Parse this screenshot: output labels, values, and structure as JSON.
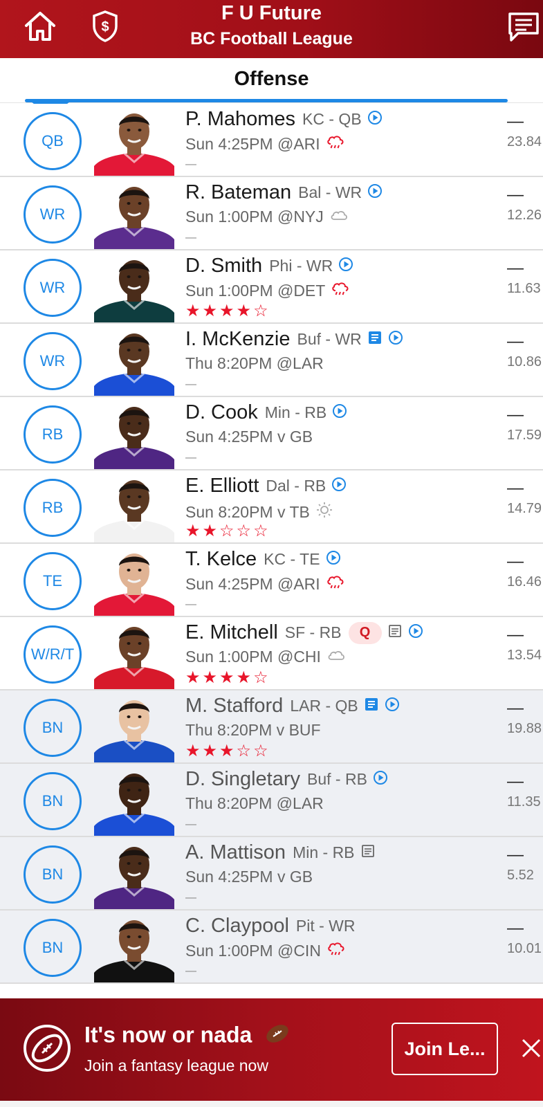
{
  "header": {
    "title": "F U Future",
    "subtitle": "BC Football League",
    "icons": [
      "home-icon",
      "dollar-shield-icon",
      "chat-icon"
    ]
  },
  "tabs": {
    "active": "Offense"
  },
  "players": [
    {
      "slot": "QB",
      "name": "P. Mahomes",
      "team_pos": "KC - QB",
      "game": "Sun 4:25PM @ARI",
      "weather": "rain",
      "rating": null,
      "badge": "",
      "note": "",
      "projected": "—",
      "points": "23.84",
      "jersey": "#e31837",
      "skin": "#8a5a3c",
      "bench": false
    },
    {
      "slot": "WR",
      "name": "R. Bateman",
      "team_pos": "Bal - WR",
      "game": "Sun 1:00PM @NYJ",
      "weather": "cloud",
      "rating": null,
      "badge": "",
      "note": "",
      "projected": "—",
      "points": "12.26",
      "jersey": "#5b2d8e",
      "skin": "#6b4128",
      "bench": false
    },
    {
      "slot": "WR",
      "name": "D. Smith",
      "team_pos": "Phi - WR",
      "game": "Sun 1:00PM @DET",
      "weather": "rain",
      "rating": 4,
      "badge": "",
      "note": "",
      "projected": "—",
      "points": "11.63",
      "jersey": "#0e3d3f",
      "skin": "#4a2c1a",
      "bench": false
    },
    {
      "slot": "WR",
      "name": "I. McKenzie",
      "team_pos": "Buf - WR",
      "game": "Thu 8:20PM @LAR",
      "weather": "",
      "rating": null,
      "badge": "",
      "note": "blue",
      "projected": "—",
      "points": "10.86",
      "jersey": "#1b4fd6",
      "skin": "#5a3822",
      "bench": false
    },
    {
      "slot": "RB",
      "name": "D. Cook",
      "team_pos": "Min - RB",
      "game": "Sun 4:25PM v GB",
      "weather": "",
      "rating": null,
      "badge": "",
      "note": "",
      "projected": "—",
      "points": "17.59",
      "jersey": "#4f2683",
      "skin": "#4a2c1a",
      "bench": false
    },
    {
      "slot": "RB",
      "name": "E. Elliott",
      "team_pos": "Dal - RB",
      "game": "Sun 8:20PM v TB",
      "weather": "sun",
      "rating": 2,
      "badge": "",
      "note": "",
      "projected": "—",
      "points": "14.79",
      "jersey": "#f2f2f2",
      "skin": "#5a3822",
      "bench": false
    },
    {
      "slot": "TE",
      "name": "T. Kelce",
      "team_pos": "KC - TE",
      "game": "Sun 4:25PM @ARI",
      "weather": "rain",
      "rating": null,
      "badge": "",
      "note": "",
      "projected": "—",
      "points": "16.46",
      "jersey": "#e31837",
      "skin": "#e0b394",
      "bench": false
    },
    {
      "slot": "W/R/T",
      "name": "E. Mitchell",
      "team_pos": "SF - RB",
      "game": "Sun 1:00PM @CHI",
      "weather": "cloud",
      "rating": 4,
      "badge": "Q",
      "note": "gray",
      "projected": "—",
      "points": "13.54",
      "jersey": "#d7192b",
      "skin": "#6b4128",
      "bench": false
    },
    {
      "slot": "BN",
      "name": "M. Stafford",
      "team_pos": "LAR - QB",
      "game": "Thu 8:20PM v BUF",
      "weather": "",
      "rating": 3,
      "badge": "",
      "note": "blue",
      "projected": "—",
      "points": "19.88",
      "jersey": "#1a4fc4",
      "skin": "#e8c2a2",
      "bench": true
    },
    {
      "slot": "BN",
      "name": "D. Singletary",
      "team_pos": "Buf - RB",
      "game": "Thu 8:20PM @LAR",
      "weather": "",
      "rating": null,
      "badge": "",
      "note": "",
      "projected": "—",
      "points": "11.35",
      "jersey": "#1b4fd6",
      "skin": "#3f2414",
      "bench": true
    },
    {
      "slot": "BN",
      "name": "A. Mattison",
      "team_pos": "Min - RB",
      "game": "Sun 4:25PM v GB",
      "weather": "",
      "rating": null,
      "badge": "",
      "note": "gray",
      "noplay": true,
      "projected": "—",
      "points": "5.52",
      "jersey": "#4f2683",
      "skin": "#4a2c1a",
      "bench": true
    },
    {
      "slot": "BN",
      "name": "C. Claypool",
      "team_pos": "Pit - WR",
      "game": "Sun 1:00PM @CIN",
      "weather": "rain",
      "rating": null,
      "badge": "",
      "note": "",
      "noplay": true,
      "projected": "—",
      "points": "10.01",
      "jersey": "#111111",
      "skin": "#7a4c30",
      "bench": true
    }
  ],
  "banner": {
    "title": "It's now or nada",
    "subtitle": "Join a fantasy league now",
    "cta": "Join Le...",
    "close": "×"
  },
  "colors": {
    "brand_red": "#b1151c",
    "accent_blue": "#1e88e5",
    "star_red": "#e8152a"
  }
}
